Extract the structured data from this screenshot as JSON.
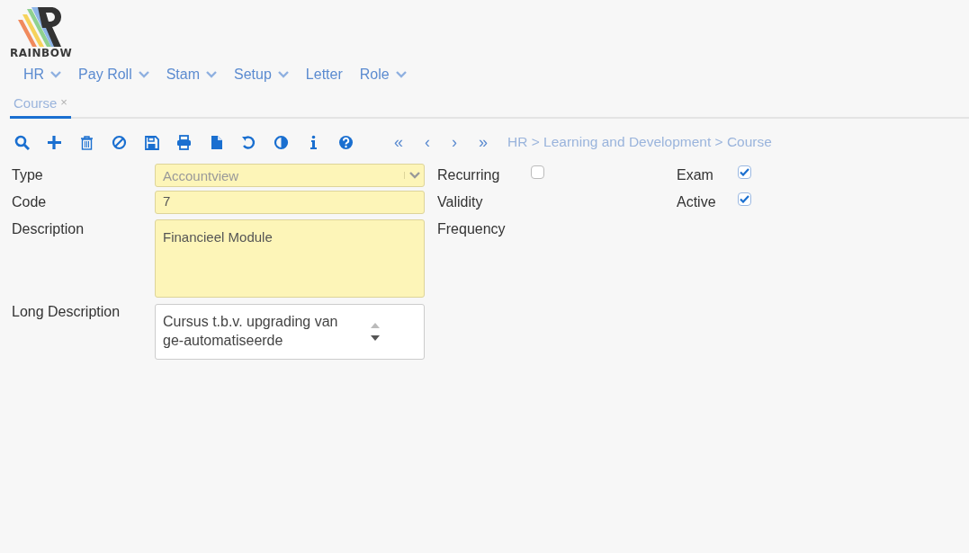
{
  "brand": {
    "name": "RAINBOW"
  },
  "menu": [
    {
      "label": "HR",
      "dropdown": true
    },
    {
      "label": "Pay Roll",
      "dropdown": true
    },
    {
      "label": "Stam",
      "dropdown": true
    },
    {
      "label": "Setup",
      "dropdown": true
    },
    {
      "label": "Letter",
      "dropdown": false
    },
    {
      "label": "Role",
      "dropdown": true
    }
  ],
  "tabs": [
    {
      "label": "Course",
      "close": "×",
      "selected": true
    }
  ],
  "toolbar": [
    {
      "kind": "search"
    },
    {
      "kind": "add"
    },
    {
      "kind": "delete"
    },
    {
      "kind": "cancel"
    },
    {
      "kind": "save"
    },
    {
      "kind": "print"
    },
    {
      "kind": "file"
    },
    {
      "kind": "undo"
    },
    {
      "kind": "contrast"
    },
    {
      "kind": "info"
    },
    {
      "kind": "help"
    }
  ],
  "nav": [
    "«",
    "‹",
    "›",
    "»"
  ],
  "breadcrumb": "HR > Learning and Development > Course",
  "form": {
    "column_1": [
      {
        "label": "Type",
        "kind": "select",
        "value": "Accountview"
      },
      {
        "label": "Code",
        "kind": "input",
        "value": "7"
      },
      {
        "label": "Description",
        "kind": "textarea",
        "value": "Financieel Module"
      },
      {
        "label": "Long Description",
        "kind": "scrollbox",
        "value": "Cursus t.b.v. upgrading van ge-automatiseerde"
      }
    ],
    "column_2": [
      {
        "label": "Recurring",
        "kind": "checkbox",
        "checked": false
      },
      {
        "label": "Validity",
        "kind": "text"
      },
      {
        "label": "Frequency",
        "kind": "text"
      }
    ],
    "column_3": [
      {
        "label": "Exam",
        "kind": "checkbox",
        "checked": true
      },
      {
        "label": "Active",
        "kind": "checkbox",
        "checked": true
      }
    ]
  }
}
